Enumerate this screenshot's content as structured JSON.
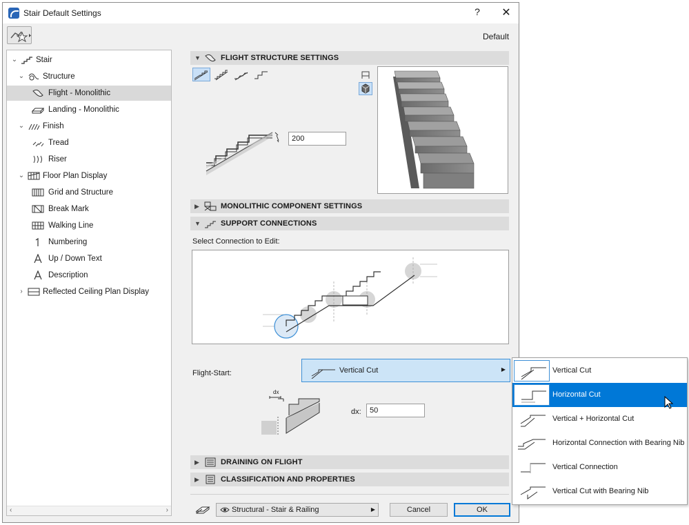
{
  "window": {
    "title": "Stair Default Settings",
    "help": "?",
    "close": "✕"
  },
  "header": {
    "default_label": "Default"
  },
  "tree": {
    "items": [
      {
        "label": "Stair",
        "arrow": "⌄"
      },
      {
        "label": "Structure",
        "arrow": "⌄"
      },
      {
        "label": "Flight - Monolithic",
        "arrow": ""
      },
      {
        "label": "Landing - Monolithic",
        "arrow": ""
      },
      {
        "label": "Finish",
        "arrow": "⌄"
      },
      {
        "label": "Tread",
        "arrow": ""
      },
      {
        "label": "Riser",
        "arrow": ""
      },
      {
        "label": "Floor Plan Display",
        "arrow": "⌄"
      },
      {
        "label": "Grid and Structure",
        "arrow": ""
      },
      {
        "label": "Break Mark",
        "arrow": ""
      },
      {
        "label": "Walking Line",
        "arrow": ""
      },
      {
        "label": "Numbering",
        "arrow": ""
      },
      {
        "label": "Up / Down Text",
        "arrow": ""
      },
      {
        "label": "Description",
        "arrow": ""
      },
      {
        "label": "Reflected Ceiling Plan Display",
        "arrow": "›"
      }
    ],
    "selected_index": 2,
    "scroll_left": "‹",
    "scroll_right": "›"
  },
  "sections": {
    "flight_structure": "FLIGHT STRUCTURE SETTINGS",
    "monolithic": "MONOLITHIC COMPONENT SETTINGS",
    "support": "SUPPORT CONNECTIONS",
    "draining": "DRAINING ON FLIGHT",
    "classification": "CLASSIFICATION AND PROPERTIES"
  },
  "flight": {
    "thickness_value": "200"
  },
  "support": {
    "select_label": "Select Connection to Edit:",
    "flight_start_label": "Flight-Start:",
    "selected_option": "Vertical Cut",
    "dx_label": "dx:",
    "dx_value": "50",
    "dx_diagram_label": "dx"
  },
  "popup": {
    "options": [
      "Vertical Cut",
      "Horizontal Cut",
      "Vertical + Horizontal Cut",
      "Horizontal Connection with Bearing Nib",
      "Vertical Connection",
      "Vertical Cut with Bearing Nib"
    ],
    "highlighted_index": 1
  },
  "footer": {
    "favorite_layer": "Structural - Stair & Railing",
    "cancel": "Cancel",
    "ok": "OK"
  },
  "colors": {
    "accent": "#0078d7",
    "selection_bg": "#cce4f7",
    "section_bg": "#dcdcdc"
  }
}
